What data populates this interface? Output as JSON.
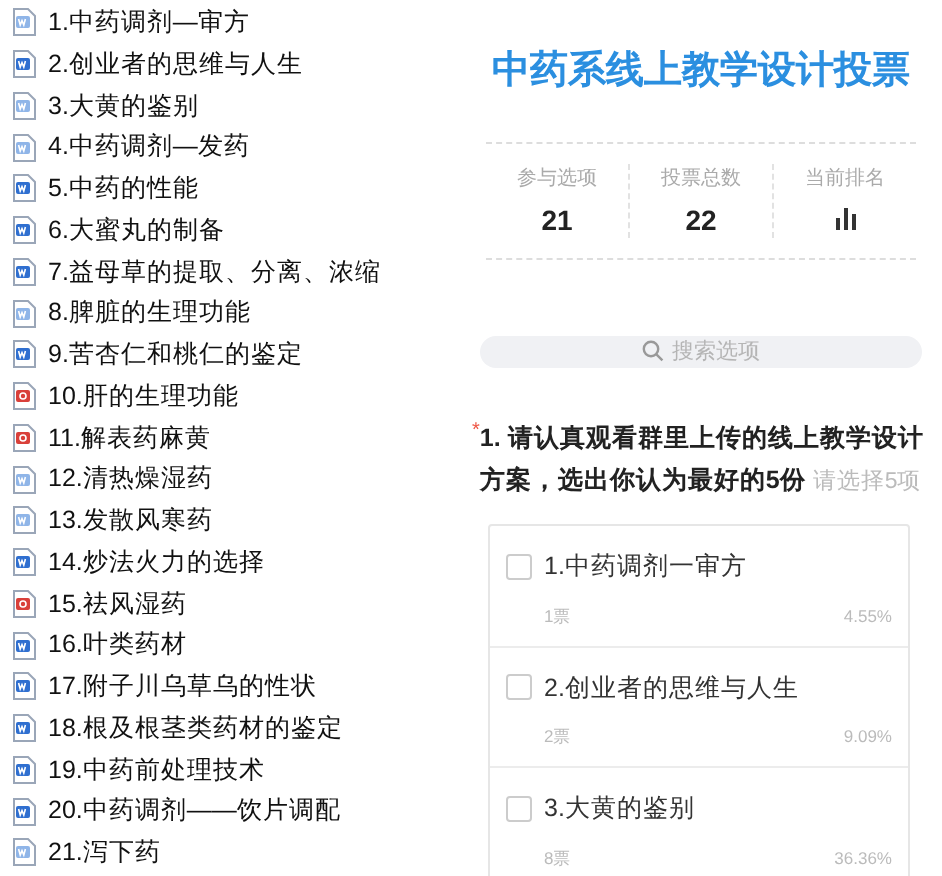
{
  "files": [
    {
      "name": "1.中药调剂—审方",
      "kind": "word-light"
    },
    {
      "name": "2.创业者的思维与人生",
      "kind": "word"
    },
    {
      "name": "3.大黄的鉴别",
      "kind": "word-light"
    },
    {
      "name": "4.中药调剂—发药",
      "kind": "word-light"
    },
    {
      "name": "5.中药的性能",
      "kind": "word"
    },
    {
      "name": "6.大蜜丸的制备",
      "kind": "word"
    },
    {
      "name": "7.益母草的提取、分离、浓缩",
      "kind": "word"
    },
    {
      "name": "8.脾脏的生理功能",
      "kind": "word-light"
    },
    {
      "name": "9.苦杏仁和桃仁的鉴定",
      "kind": "word"
    },
    {
      "name": "10.肝的生理功能",
      "kind": "pdf"
    },
    {
      "name": "11.解表药麻黄",
      "kind": "pdf"
    },
    {
      "name": "12.清热燥湿药",
      "kind": "word-light"
    },
    {
      "name": "13.发散风寒药",
      "kind": "word-light"
    },
    {
      "name": "14.炒法火力的选择",
      "kind": "word"
    },
    {
      "name": "15.祛风湿药",
      "kind": "pdf"
    },
    {
      "name": "16.叶类药材",
      "kind": "word"
    },
    {
      "name": "17.附子川乌草乌的性状",
      "kind": "word"
    },
    {
      "name": "18.根及根茎类药材的鉴定",
      "kind": "word"
    },
    {
      "name": "19.中药前处理技术",
      "kind": "word"
    },
    {
      "name": "20.中药调剂——饮片调配",
      "kind": "word"
    },
    {
      "name": "21.泻下药",
      "kind": "word-light"
    }
  ],
  "poll": {
    "title": "中药系线上教学设计投票",
    "stats": [
      {
        "label": "参与选项",
        "value": "21"
      },
      {
        "label": "投票总数",
        "value": "22"
      },
      {
        "label": "当前排名",
        "kind": "ranking"
      }
    ],
    "search": {
      "placeholder": "搜索选项"
    },
    "question": {
      "required_mark": "*",
      "text": "1. 请认真观看群里上传的线上教学设计方案，选出你认为最好的5份",
      "hint": "请选择5项"
    },
    "options": [
      {
        "label": "1.中药调剂一审方",
        "votes": "1票",
        "percent": "4.55%",
        "checked": false
      },
      {
        "label": "2.创业者的思维与人生",
        "votes": "2票",
        "percent": "9.09%",
        "checked": false
      },
      {
        "label": "3.大黄的鉴别",
        "votes": "8票",
        "percent": "36.36%",
        "checked": false
      }
    ]
  }
}
